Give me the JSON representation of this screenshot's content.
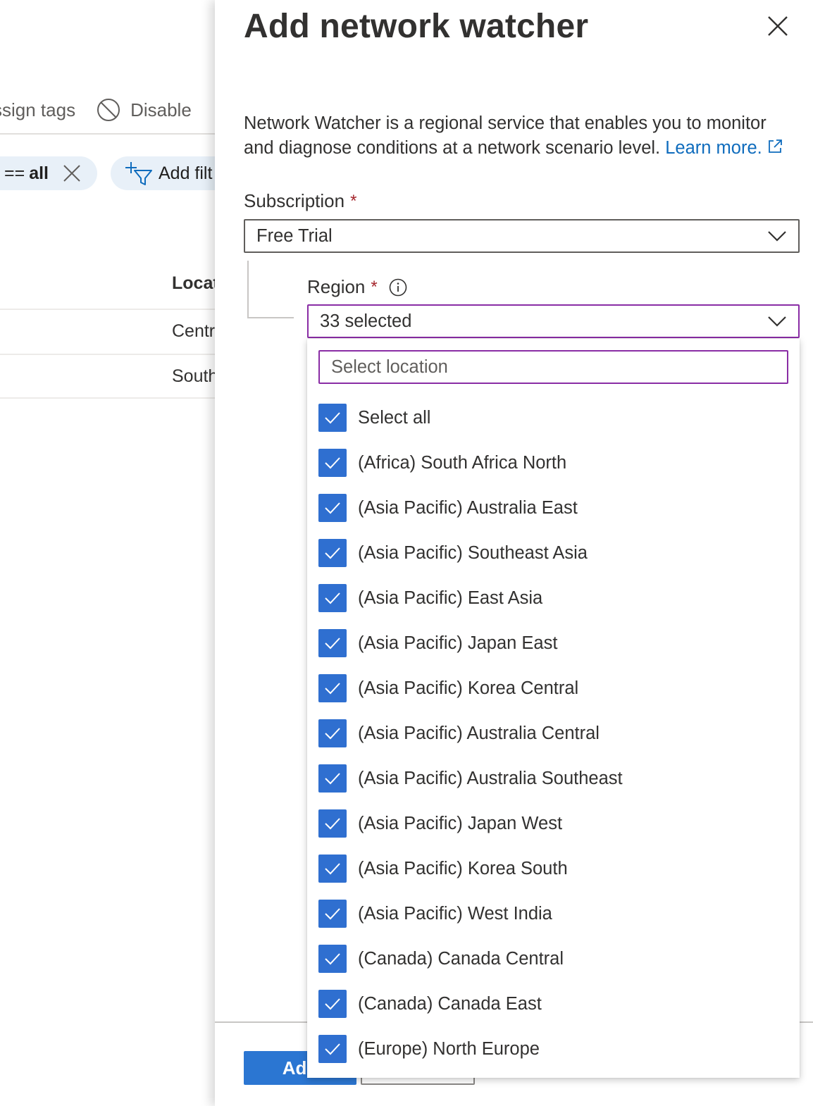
{
  "background": {
    "toolbar": {
      "assign_tags_label": "ssign tags",
      "disable_label": "Disable"
    },
    "filter_pill": {
      "operator": "==",
      "value": "all"
    },
    "add_filter_label": "Add filt",
    "column_header": "Locat",
    "rows": [
      "Centr",
      "South"
    ]
  },
  "panel": {
    "title": "Add network watcher",
    "description": "Network Watcher is a regional service that enables you to monitor and diagnose conditions at a network scenario level.",
    "learn_more": "Learn more.",
    "subscription": {
      "label": "Subscription",
      "required_mark": "*",
      "value": "Free Trial"
    },
    "region": {
      "label": "Region",
      "required_mark": "*",
      "value": "33 selected",
      "search_placeholder": "Select location",
      "options": [
        {
          "label": "Select all",
          "checked": true
        },
        {
          "label": "(Africa) South Africa North",
          "checked": true
        },
        {
          "label": "(Asia Pacific) Australia East",
          "checked": true
        },
        {
          "label": "(Asia Pacific) Southeast Asia",
          "checked": true
        },
        {
          "label": "(Asia Pacific) East Asia",
          "checked": true
        },
        {
          "label": "(Asia Pacific) Japan East",
          "checked": true
        },
        {
          "label": "(Asia Pacific) Korea Central",
          "checked": true
        },
        {
          "label": "(Asia Pacific) Australia Central",
          "checked": true
        },
        {
          "label": "(Asia Pacific) Australia Southeast",
          "checked": true
        },
        {
          "label": "(Asia Pacific) Japan West",
          "checked": true
        },
        {
          "label": "(Asia Pacific) Korea South",
          "checked": true
        },
        {
          "label": "(Asia Pacific) West India",
          "checked": true
        },
        {
          "label": "(Canada) Canada Central",
          "checked": true
        },
        {
          "label": "(Canada) Canada East",
          "checked": true
        },
        {
          "label": "(Europe) North Europe",
          "checked": true
        }
      ]
    },
    "footer": {
      "primary_label": "Add"
    }
  },
  "colors": {
    "accent": "#2f6fd0",
    "focus_border": "#8a2da5",
    "link": "#0f6cbd",
    "required": "#a4262c"
  }
}
